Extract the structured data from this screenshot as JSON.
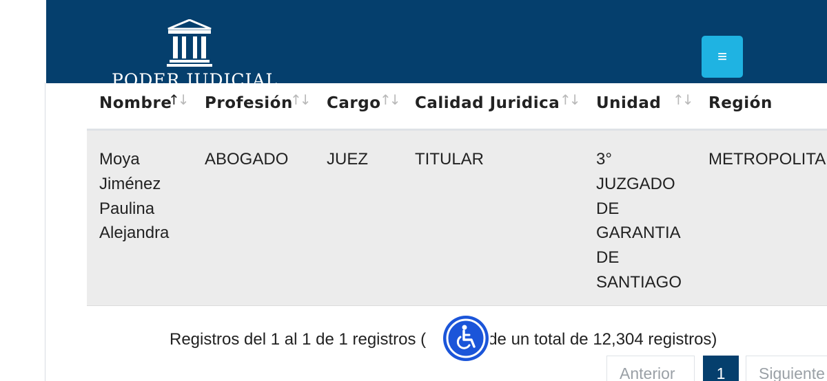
{
  "header": {
    "logo_text": "PODER JUDICIAL",
    "menu_icon": "≡"
  },
  "table": {
    "columns": [
      {
        "label": "Nombre",
        "sort": "ascending"
      },
      {
        "label": "Profesión",
        "sort": "none"
      },
      {
        "label": "Cargo",
        "sort": "none"
      },
      {
        "label": "Calidad Juridica",
        "sort": "none"
      },
      {
        "label": "Unidad",
        "sort": "none"
      },
      {
        "label": "Región",
        "sort": "none"
      }
    ],
    "row": {
      "nombre": [
        "Moya",
        "Jiménez",
        "Paulina",
        "Alejandra"
      ],
      "profesion": "ABOGADO",
      "cargo": "JUEZ",
      "calidad": "TITULAR",
      "unidad": [
        "3°",
        "JUZGADO",
        "DE",
        "GARANTIA",
        "DE",
        "SANTIAGO"
      ],
      "region": "METROPOLITA"
    }
  },
  "footer": {
    "info_left": "Registros del 1 al 1 de 1 registros (",
    "info_right": "o de un total de 12,304 registros)"
  },
  "pagination": {
    "prev": "Anterior",
    "current": "1",
    "next": "Siguiente"
  },
  "colors": {
    "header_bg": "#053f6d",
    "menu_button": "#1fb3e2",
    "accessibility_button": "#1b55d9",
    "row_bg": "#ececec"
  }
}
